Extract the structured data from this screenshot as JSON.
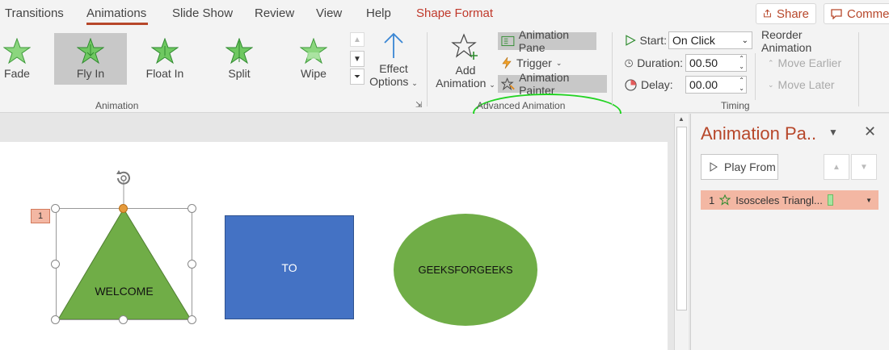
{
  "tabs": {
    "items": [
      "Transitions",
      "Animations",
      "Slide Show",
      "Review",
      "View",
      "Help",
      "Shape Format"
    ],
    "active": "Animations",
    "share_label": "Share",
    "comments_label": "Comme"
  },
  "ribbon": {
    "animation_gallery": [
      {
        "label": "Fade"
      },
      {
        "label": "Fly In"
      },
      {
        "label": "Float In"
      },
      {
        "label": "Split"
      },
      {
        "label": "Wipe"
      }
    ],
    "effect_options": {
      "line1": "Effect",
      "line2": "Options"
    },
    "animation_group_label": "Animation",
    "add_animation": {
      "line1": "Add",
      "line2": "Animation"
    },
    "animation_pane_label": "Animation Pane",
    "trigger_label": "Trigger",
    "animation_painter_label": "Animation Painter",
    "advanced_animation_label": "Advanced Animation",
    "start_label": "Start:",
    "start_value": "On Click",
    "duration_label": "Duration:",
    "duration_value": "00.50",
    "delay_label": "Delay:",
    "delay_value": "00.00",
    "timing_label": "Timing",
    "reorder_label": "Reorder Animation",
    "move_earlier_label": "Move Earlier",
    "move_later_label": "Move Later"
  },
  "pane": {
    "title": "Animation Pa..",
    "play_from_label": "Play From",
    "items": [
      {
        "number": "1",
        "label": "Isosceles Triangl..."
      }
    ]
  },
  "slide": {
    "order_tag": "1",
    "triangle_text": "WELCOME",
    "rectangle_text": "TO",
    "ellipse_text": "GEEKSFORGEEKS"
  },
  "colors": {
    "accent": "#b7472a",
    "triangle": "#70ad47",
    "rectangle": "#4472c4",
    "ellipse": "#70ad47",
    "highlight_oval": "#22d322",
    "selected_anim": "#f3b7a3"
  }
}
